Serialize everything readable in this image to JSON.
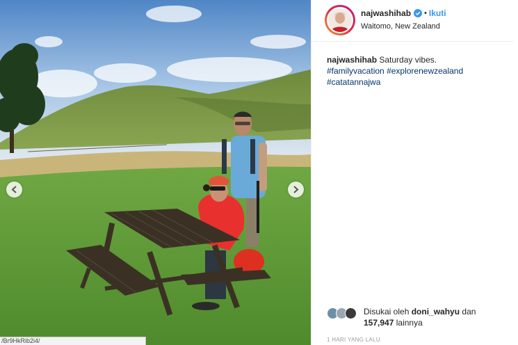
{
  "post": {
    "username": "najwashihab",
    "follow_label": "Ikuti",
    "location": "Waitomo, New Zealand",
    "caption": {
      "username": "najwashihab",
      "text": "Saturday vibes.",
      "hashtags": [
        "#familyvacation",
        "#explorenewzealand",
        "#catatannajwa"
      ]
    },
    "likes": {
      "prefix": "Disukai oleh",
      "user": "doni_wahyu",
      "conjunction": "dan",
      "count": "157,947",
      "suffix": "lainnya"
    },
    "timestamp": "1 HARI YANG LALU"
  },
  "browser": {
    "status_url": "/Br9HkRib2i4/"
  },
  "icons": {
    "verified": "verified-badge-icon",
    "prev": "chevron-left-icon",
    "next": "chevron-right-icon"
  },
  "colors": {
    "follow_blue": "#3897f0",
    "hashtag": "#003569",
    "timestamp_gray": "#999999",
    "jacket_red": "#e8302f"
  }
}
